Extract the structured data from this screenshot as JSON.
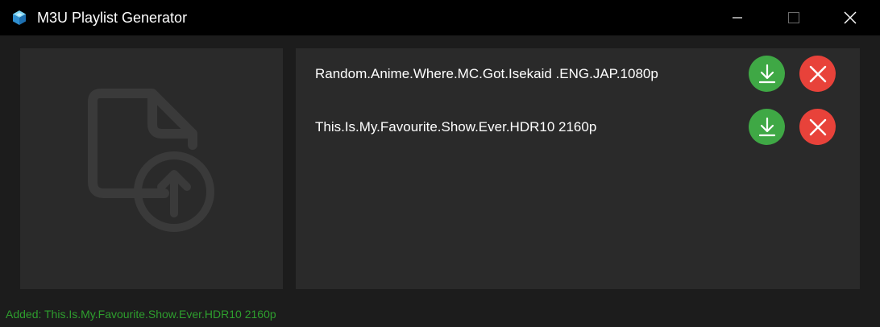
{
  "window": {
    "title": "M3U Playlist Generator",
    "icon": "app-cube-icon"
  },
  "controls": {
    "minimize_icon": "minimize-icon",
    "maximize_icon": "maximize-icon",
    "close_icon": "close-icon"
  },
  "drop_zone": {
    "icon": "file-upload-icon"
  },
  "playlist": {
    "items": [
      {
        "label": "Random.Anime.Where.MC.Got.Isekaid .ENG.JAP.1080p",
        "download_icon": "download-icon",
        "remove_icon": "remove-icon"
      },
      {
        "label": "This.Is.My.Favourite.Show.Ever.HDR10 2160p",
        "download_icon": "download-icon",
        "remove_icon": "remove-icon"
      }
    ]
  },
  "status": {
    "text": "Added: This.Is.My.Favourite.Show.Ever.HDR10 2160p"
  },
  "colors": {
    "accent_green": "#3fa845",
    "accent_red": "#e8423a",
    "status_green": "#2e9e2e",
    "panel": "#2a2a2a",
    "background": "#1c1c1c",
    "titlebar": "#000000",
    "icon_muted": "#3a3a3a"
  }
}
